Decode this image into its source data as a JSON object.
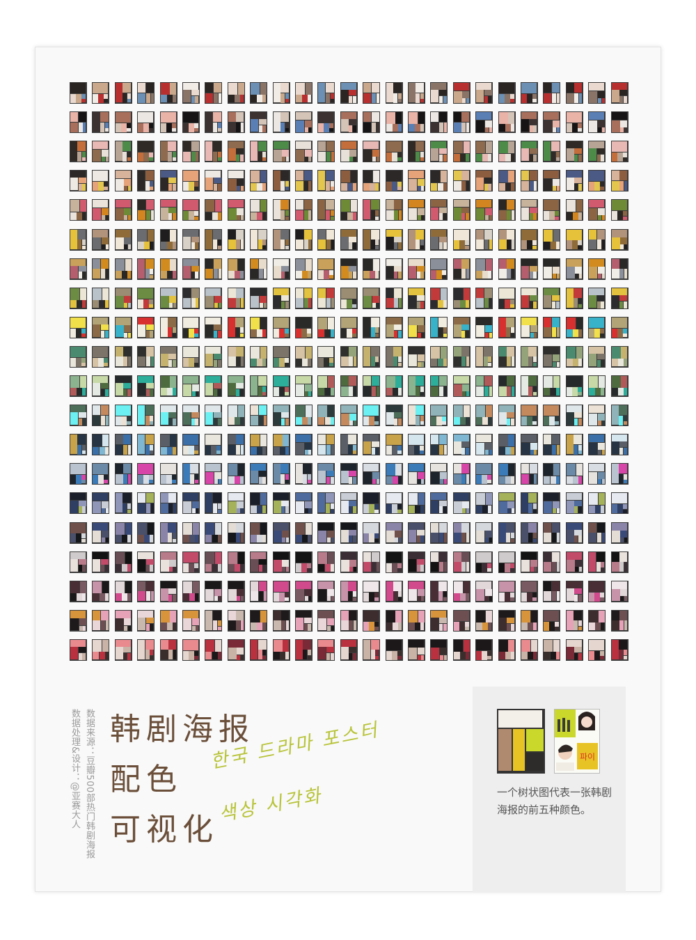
{
  "title_lines": [
    "韩剧海报",
    "配色",
    "可视化"
  ],
  "korean_lines": [
    "한국 드라마 포스터",
    "색상 시각화"
  ],
  "credits": [
    "数据来源：豆瓣500部热门韩剧海报",
    "数据处理&设计：@亚赛大人"
  ],
  "legend": {
    "caption": "一个树状图代表一张韩剧海报的前五种颜色。",
    "sample_colors": [
      "#f3efe9",
      "#b08a6e",
      "#e8c326",
      "#c9d82a",
      "#2e2c2a"
    ]
  },
  "colors": {
    "title": "#6b4f3a",
    "korean": "#b8c43a",
    "credit": "#9a9a9a",
    "tile_border": "#3a3a3a",
    "poster_bg": "#f9f9f9",
    "legend_bg": "#eeeeee"
  },
  "grid": {
    "rows": 20,
    "cols": 25,
    "row_palettes": [
      [
        "#e9d9cf",
        "#c9a88c",
        "#8a7468",
        "#2a2423",
        "#b82f2f",
        "#f1ece6",
        "#6c8fb4"
      ],
      [
        "#171415",
        "#ece7e2",
        "#a86f5c",
        "#e9b3a8",
        "#5a7fb5",
        "#3c3232",
        "#d4c4b8"
      ],
      [
        "#2f2a25",
        "#8e6a4e",
        "#e7e1d9",
        "#c46e3b",
        "#4d8b49",
        "#b8a495",
        "#e8b9b4"
      ],
      [
        "#d8b39c",
        "#2c2828",
        "#eee9e3",
        "#8d5d3f",
        "#e6a37a",
        "#4b5a84",
        "#e2c64d"
      ],
      [
        "#eae3db",
        "#c7b29c",
        "#2b2725",
        "#8a6443",
        "#d3861f",
        "#6f8a36",
        "#d25a6e"
      ],
      [
        "#f0e7d8",
        "#1f1d1d",
        "#b1927a",
        "#e5c23a",
        "#6b6c70",
        "#8f6b3a",
        "#d8d1c8"
      ],
      [
        "#e8ddcc",
        "#2a2827",
        "#c9a15b",
        "#d28b1e",
        "#8a8f99",
        "#f0ede6",
        "#b55e6d"
      ],
      [
        "#ece6d6",
        "#2c2b2d",
        "#9a8d73",
        "#e3c23f",
        "#6b8c42",
        "#c33a3a",
        "#b9c1c9"
      ],
      [
        "#f1ece0",
        "#2a2a28",
        "#b3a477",
        "#f2e04a",
        "#37b2c9",
        "#8b6b47",
        "#d82f2f"
      ],
      [
        "#e9e6dc",
        "#2f302d",
        "#95a37b",
        "#c6b26f",
        "#4a8a6e",
        "#7c7468",
        "#d6c2a4"
      ],
      [
        "#e5e9e3",
        "#262a2a",
        "#8bb38e",
        "#c8d9a8",
        "#4e6b3f",
        "#b05a5a",
        "#2cae9b"
      ],
      [
        "#dfe7ea",
        "#2d3a3c",
        "#8fb3b8",
        "#6cf0f2",
        "#c48a5e",
        "#4d6f5a",
        "#ece3d6"
      ],
      [
        "#d6e6ee",
        "#263443",
        "#7fb7d2",
        "#3a6fa8",
        "#e9e6de",
        "#5a5e66",
        "#c9a34a"
      ],
      [
        "#d8dde4",
        "#1d242c",
        "#6b8aa8",
        "#3b7bb8",
        "#b8c3cf",
        "#e6e3df",
        "#d845a8"
      ],
      [
        "#e6e9ef",
        "#1b1f2a",
        "#4f6b9e",
        "#8f96b8",
        "#c9cdd6",
        "#2e3f63",
        "#a5b25a"
      ],
      [
        "#d5d8dd",
        "#15171b",
        "#4a4f6a",
        "#8a84a8",
        "#e3ddd5",
        "#70504a",
        "#3a4a78"
      ],
      [
        "#cfcacb",
        "#141314",
        "#6a4e55",
        "#b77b8a",
        "#e8e1dc",
        "#3b2f35",
        "#c24b6a"
      ],
      [
        "#e2d8da",
        "#1b1819",
        "#7a5a62",
        "#c693a8",
        "#eee6e8",
        "#4a2e35",
        "#d04a8c"
      ],
      [
        "#e8d6d8",
        "#1e1a1b",
        "#6d4f52",
        "#e6a3b8",
        "#c8b8ad",
        "#3d2d2e",
        "#d8943a"
      ],
      [
        "#e6d6d0",
        "#1c1819",
        "#7a2a36",
        "#b9303e",
        "#e88a8e",
        "#c9b2a6",
        "#3a2e2c"
      ]
    ]
  }
}
